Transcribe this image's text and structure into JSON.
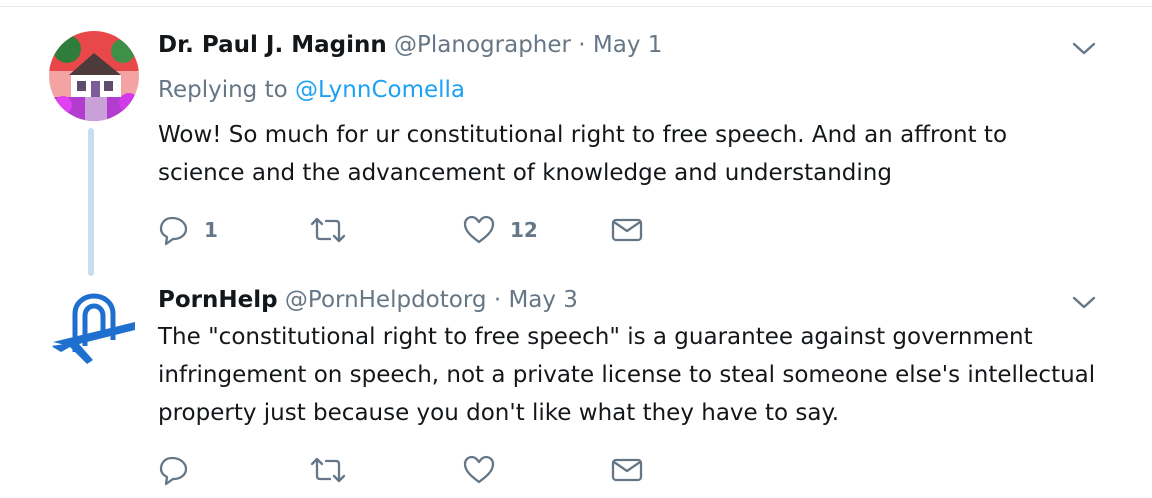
{
  "tweets": [
    {
      "author_name": "Dr. Paul J. Maginn",
      "handle": "@Planographer",
      "separator": "·",
      "date": "May 1",
      "replying_label": "Replying to",
      "replying_to": "@LynnComella",
      "text": "Wow! So much for ur constitutional right to free speech. And an affront to science and the advancement of knowledge and understanding",
      "reply_count": "1",
      "retweet_count": "",
      "like_count": "12",
      "avatar_icon": "house-photo-avatar"
    },
    {
      "author_name": "PornHelp",
      "handle": "@PornHelpdotorg",
      "separator": "·",
      "date": "May 3",
      "text": "The \"constitutional right to free speech\" is a guarantee against government infringement on speech, not a private license to steal someone else's intellectual property just because you don't like what they have to say.",
      "reply_count": "",
      "retweet_count": "",
      "like_count": "",
      "avatar_icon": "pornhelp-logo-avatar"
    }
  ],
  "icons": {
    "reply": "reply-icon",
    "retweet": "retweet-icon",
    "like": "heart-icon",
    "message": "envelope-icon",
    "more": "chevron-down-icon"
  },
  "colors": {
    "text": "#14171a",
    "secondary": "#657786",
    "link": "#1da1f2",
    "thread_line": "#c4dff2",
    "logo_blue": "#1f6fcf"
  }
}
